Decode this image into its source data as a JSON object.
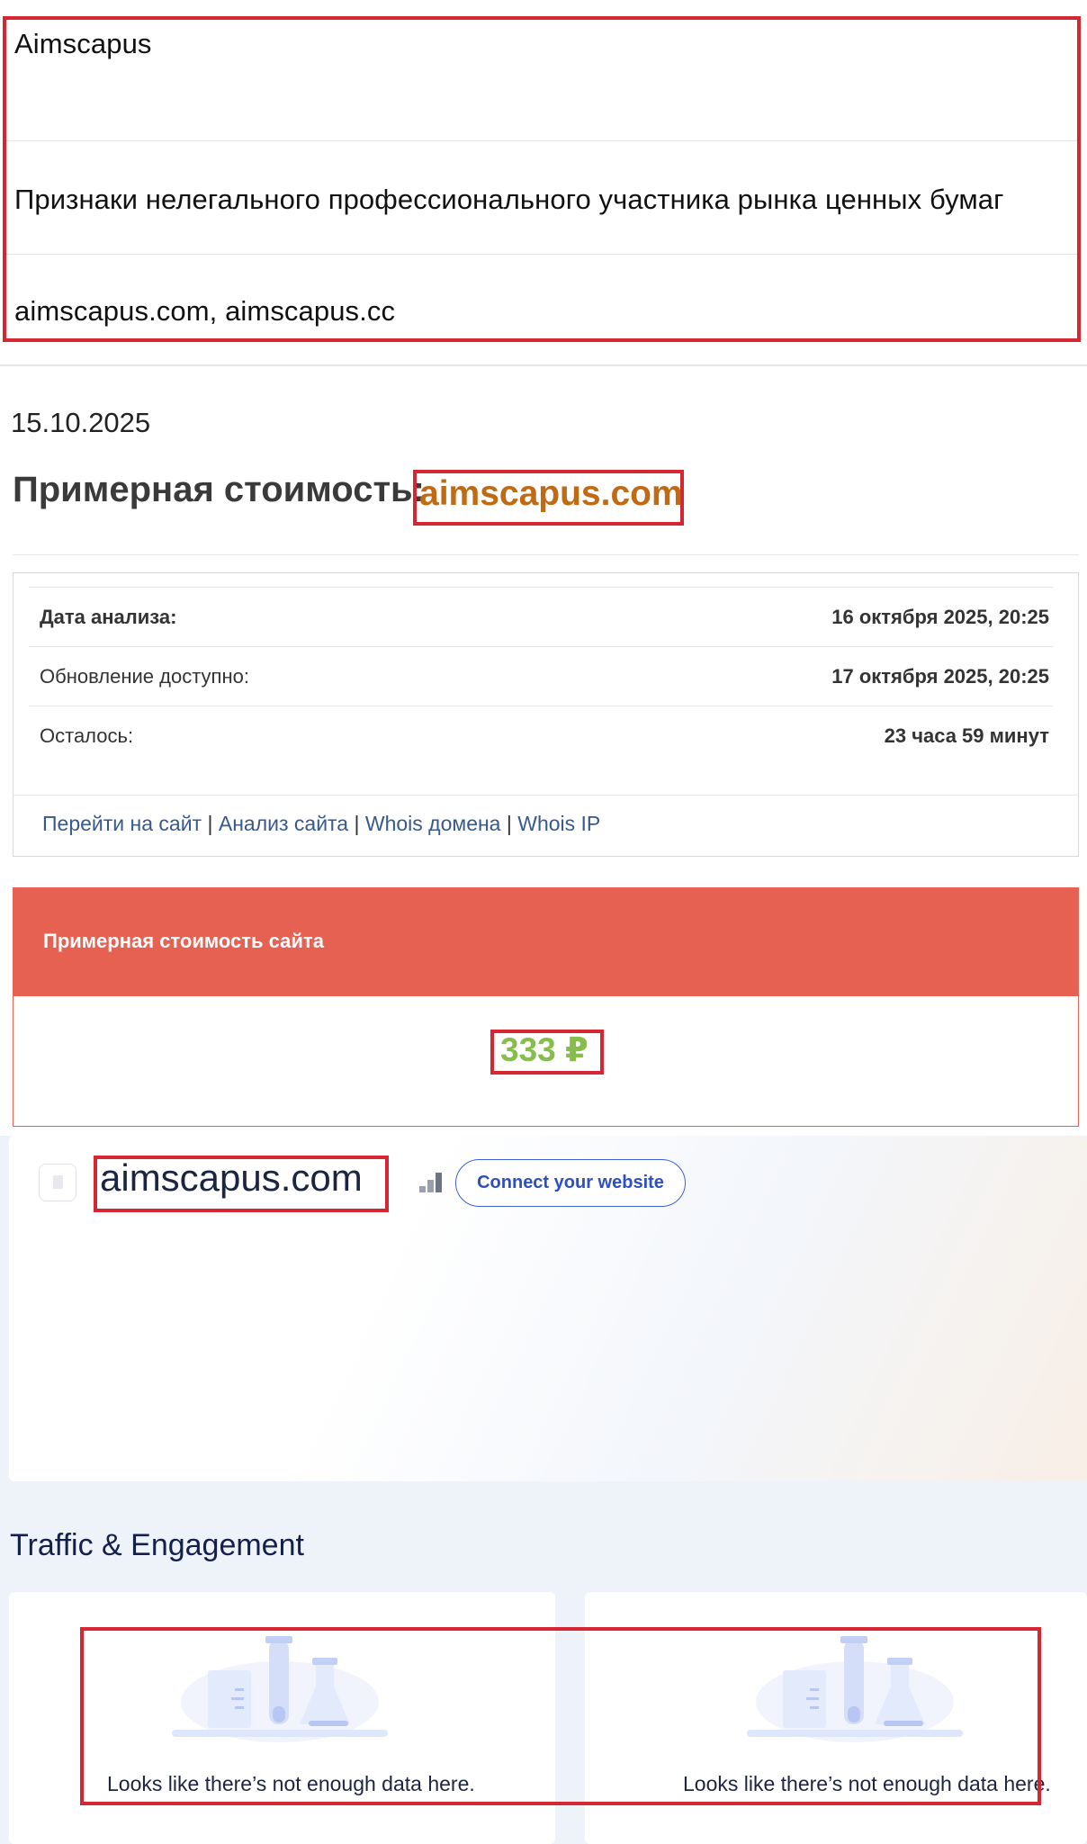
{
  "info": {
    "name": "Aimscapus",
    "category": "Признаки нелегального профессионального участника рынка ценных бумаг",
    "domains": "aimscapus.com, aimscapus.cc"
  },
  "date": "15.10.2025",
  "cost_heading": {
    "label": "Примерная стоимость:",
    "domain": "aimscapus.com"
  },
  "analysis": {
    "rows": [
      {
        "label": "Дата анализа:",
        "value": "16 октября 2025, 20:25"
      },
      {
        "label": "Обновление доступно:",
        "value": "17 октября 2025, 20:25"
      },
      {
        "label": "Осталось:",
        "value": "23 часа 59 минут"
      }
    ],
    "links": [
      "Перейти на сайт",
      "Анализ сайта",
      "Whois домена",
      "Whois IP"
    ],
    "separator": "|"
  },
  "cost_card": {
    "title": "Примерная стоимость сайта",
    "price": "333 ₽"
  },
  "site_card": {
    "domain": "aimscapus.com",
    "connect_label": "Connect your website"
  },
  "traffic": {
    "title": "Traffic & Engagement",
    "nodata_left": "Looks like there’s not enough data here.",
    "nodata_right": "Looks like there’s not enough data here."
  },
  "colors": {
    "highlight_border": "#d52631",
    "cost_header": "#e66152",
    "price": "#86bd4b",
    "domain_orange": "#c06a13",
    "link": "#37598f"
  }
}
